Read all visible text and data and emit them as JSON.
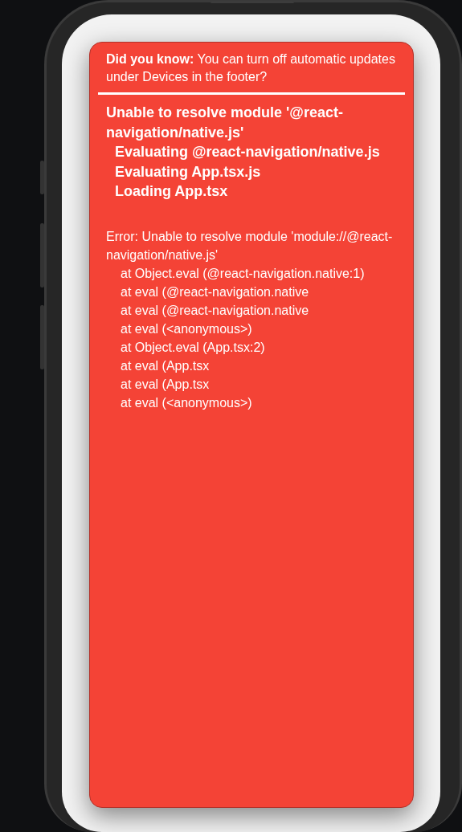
{
  "tip": "**Did you know:** You can turn off automatic updates under Devices in the footer?",
  "error_heading": {
    "title": "Unable to resolve module '@react-navigation/native.js'",
    "trace": [
      "Evaluating @react-navigation/native.js",
      "Evaluating App.tsx.js",
      "Loading App.tsx"
    ]
  },
  "error_message": "Error: Unable to resolve module 'module://@react-navigation/native.js'",
  "stack": [
    "at Object.eval (@react-navigation.native:1)",
    "at eval (@react-navigation.native",
    "at eval (@react-navigation.native",
    "at eval (<anonymous>)",
    "at Object.eval (App.tsx:2)",
    "at eval (App.tsx",
    "at eval (App.tsx",
    "at eval (<anonymous>)"
  ]
}
